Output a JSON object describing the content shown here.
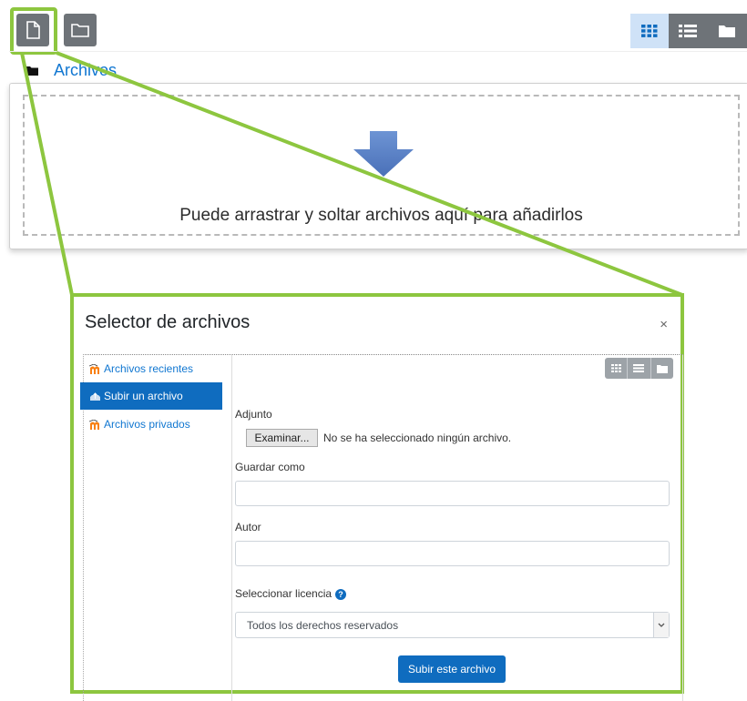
{
  "toolbar": {
    "add_file_icon": "file-icon",
    "create_folder_icon": "folder-icon",
    "views": [
      "grid-view-icon",
      "list-view-icon",
      "folder-tree-icon"
    ]
  },
  "breadcrumb": {
    "label": "Archivos"
  },
  "dropzone": {
    "text": "Puede arrastrar y soltar archivos aquí para añadirlos"
  },
  "dialog": {
    "title": "Selector de archivos",
    "close": "×",
    "sidebar": [
      {
        "label": "Archivos recientes",
        "icon": "moodle-icon",
        "active": false
      },
      {
        "label": "Subir un archivo",
        "icon": "upload-icon",
        "active": true
      },
      {
        "label": "Archivos privados",
        "icon": "moodle-icon",
        "active": false
      }
    ],
    "form": {
      "attachment_label": "Adjunto",
      "browse_button": "Examinar...",
      "no_file_text": "No se ha seleccionado ningún archivo.",
      "save_as_label": "Guardar como",
      "save_as_value": "",
      "author_label": "Autor",
      "author_value": "",
      "license_label": "Seleccionar licencia",
      "license_value": "Todos los derechos reservados",
      "submit_button": "Subir este archivo"
    }
  },
  "colors": {
    "highlight": "#8dc63f",
    "accent": "#0f6cbf",
    "active_view": "#cfe2f7"
  }
}
